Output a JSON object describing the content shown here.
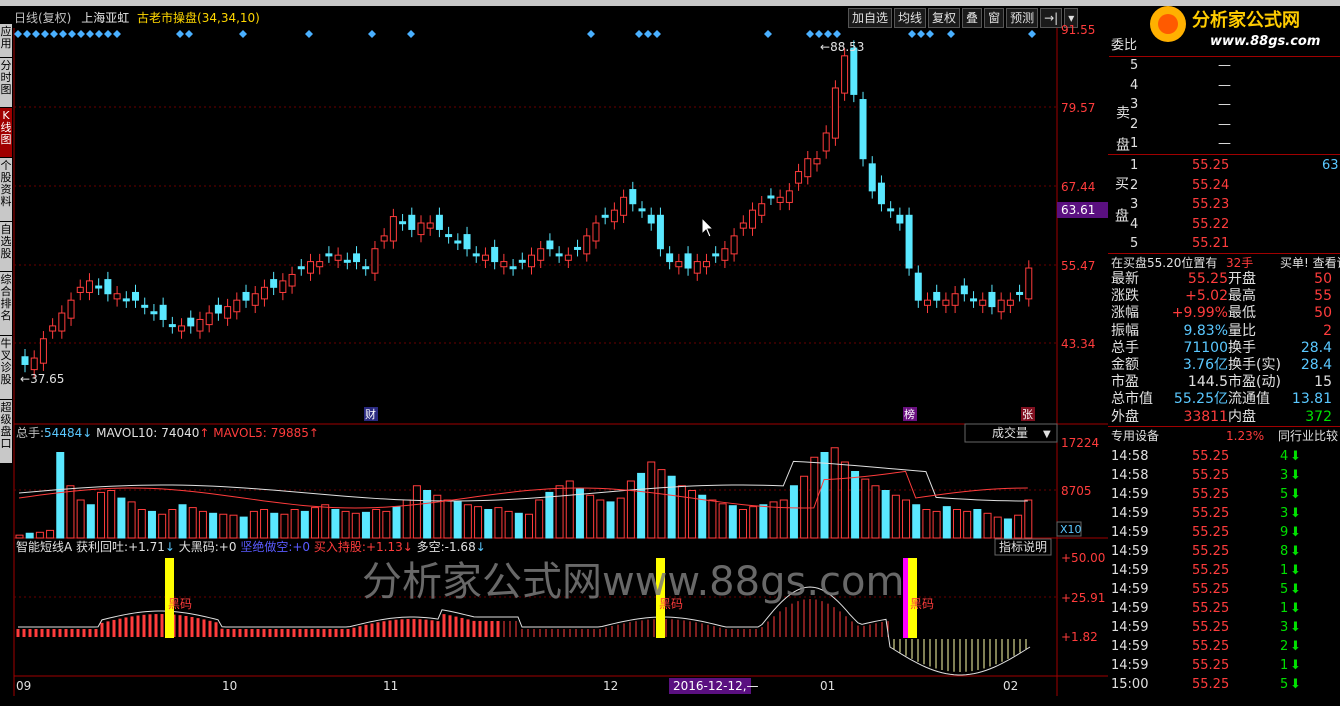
{
  "title_bar": {
    "period": "日线(复权)",
    "stock_name": "上海亚虹",
    "indicator": "古老市操盘(34,34,10)"
  },
  "toolbar": [
    "加自选",
    "均线",
    "复权",
    "叠",
    "窗",
    "预测"
  ],
  "left_tabs": [
    "应用",
    "分时图",
    "K线图",
    "个股资料",
    "自选股",
    "综合排名",
    "牛叉诊股",
    "超级盘口"
  ],
  "logo": {
    "text": "分析家公式网",
    "url": "www.88gs.com"
  },
  "main_chart": {
    "price_axis": [
      "91.55",
      "79.57",
      "67.44",
      "63.61",
      "55.47",
      "43.34"
    ],
    "high_marker": "88.53",
    "low_marker": "37.65",
    "markers": {
      "cai": "财",
      "bang": "榜",
      "zhang": "张"
    }
  },
  "volume_panel": {
    "label": "总手:",
    "total": "54484",
    "mavol10_label": "MAVOL10:",
    "mavol10": "74040",
    "mavol5_label": "MAVOL5:",
    "mavol5": "79885",
    "axis": [
      "17224",
      "8705",
      "X10"
    ],
    "selector": "成交量"
  },
  "indicator_panel": {
    "name": "智能短线A",
    "items": [
      {
        "label": "获利回吐:",
        "value": "+1.71"
      },
      {
        "label": "大黑码:",
        "value": "+0"
      },
      {
        "label": "坚绝做空:",
        "value": "+0"
      },
      {
        "label": "买入持股:",
        "value": "+1.13"
      },
      {
        "label": "多空:",
        "value": "-1.68"
      }
    ],
    "axis": [
      "+50.00",
      "+25.91",
      "+1.82"
    ],
    "explain": "指标说明",
    "black_code": "黑码",
    "watermark": "分析家公式网www.88gs.com"
  },
  "time_axis": [
    "09",
    "10",
    "11",
    "12",
    "01",
    "02"
  ],
  "date_cursor": "2016-12-12,—",
  "order_book": {
    "weibi": "委比",
    "sell_label": "卖盘",
    "buy_label": "买盘",
    "sell": [
      {
        "n": "5",
        "price": "—"
      },
      {
        "n": "4",
        "price": "—"
      },
      {
        "n": "3",
        "price": "—"
      },
      {
        "n": "2",
        "price": "—"
      },
      {
        "n": "1",
        "price": "—"
      }
    ],
    "buy": [
      {
        "n": "1",
        "price": "55.25",
        "vol": "63"
      },
      {
        "n": "2",
        "price": "55.24",
        "vol": ""
      },
      {
        "n": "3",
        "price": "55.23",
        "vol": ""
      },
      {
        "n": "4",
        "price": "55.22",
        "vol": ""
      },
      {
        "n": "5",
        "price": "55.21",
        "vol": ""
      }
    ],
    "status": "在买盘55.20位置有",
    "status_qty": "32手",
    "status_tail": "买单! 查看详"
  },
  "quote": [
    {
      "l": "最新",
      "v": "55.25",
      "l2": "开盘",
      "v2": "50"
    },
    {
      "l": "涨跌",
      "v": "+5.02",
      "l2": "最高",
      "v2": "55"
    },
    {
      "l": "涨幅",
      "v": "+9.99%",
      "l2": "最低",
      "v2": "50"
    },
    {
      "l": "振幅",
      "v": "9.83%",
      "l2": "量比",
      "v2": "2"
    },
    {
      "l": "总手",
      "v": "71100",
      "l2": "换手",
      "v2": "28.4"
    },
    {
      "l": "金额",
      "v": "3.76亿",
      "l2": "换手(实)",
      "v2": "28.4"
    },
    {
      "l": "市盈",
      "v": "144.5",
      "l2": "市盈(动)",
      "v2": "15"
    },
    {
      "l": "总市值",
      "v": "55.25亿",
      "l2": "流通值",
      "v2": "13.81"
    },
    {
      "l": "外盘",
      "v": "33811",
      "l2": "内盘",
      "v2": "372"
    }
  ],
  "sector": {
    "name": "专用设备",
    "pct": "1.23%",
    "compare": "同行业比较"
  },
  "ticks": [
    {
      "t": "14:58",
      "p": "55.25",
      "v": "4"
    },
    {
      "t": "14:58",
      "p": "55.25",
      "v": "3"
    },
    {
      "t": "14:59",
      "p": "55.25",
      "v": "5"
    },
    {
      "t": "14:59",
      "p": "55.25",
      "v": "3"
    },
    {
      "t": "14:59",
      "p": "55.25",
      "v": "9"
    },
    {
      "t": "14:59",
      "p": "55.25",
      "v": "8"
    },
    {
      "t": "14:59",
      "p": "55.25",
      "v": "1"
    },
    {
      "t": "14:59",
      "p": "55.25",
      "v": "5"
    },
    {
      "t": "14:59",
      "p": "55.25",
      "v": "1"
    },
    {
      "t": "14:59",
      "p": "55.25",
      "v": "3"
    },
    {
      "t": "14:59",
      "p": "55.25",
      "v": "2"
    },
    {
      "t": "14:59",
      "p": "55.25",
      "v": "1"
    },
    {
      "t": "15:00",
      "p": "55.25",
      "v": "5"
    }
  ]
}
